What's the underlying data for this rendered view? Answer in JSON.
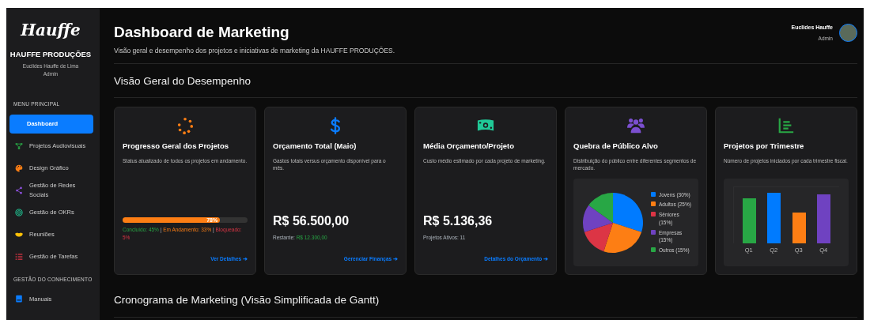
{
  "sidebar": {
    "logo": "Hauffe",
    "company": "HAUFFE PRODUÇÕES",
    "user_name": "Euclides Hauffe de Lima",
    "user_role": "Admin",
    "sections": [
      {
        "title": "MENU PRINCIPAL",
        "items": [
          {
            "label": "Dashboard",
            "selected": true
          },
          {
            "label": "Projetos Audiovisuais",
            "selected": false
          },
          {
            "label": "Design Gráfico",
            "selected": false
          },
          {
            "label": "Gestão de Redes Sociais",
            "selected": false
          },
          {
            "label": "Gestão de OKRs",
            "selected": false
          },
          {
            "label": "Reuniões",
            "selected": false
          },
          {
            "label": "Gestão de Tarefas",
            "selected": false
          }
        ]
      },
      {
        "title": "GESTÃO DO CONHECIMENTO",
        "items": [
          {
            "label": "Manuais",
            "selected": false
          }
        ]
      }
    ]
  },
  "header": {
    "title": "Dashboard de Marketing",
    "subtitle": "Visão geral e desempenho dos projetos e iniciativas de marketing da HAUFFE PRODUÇÕES.",
    "user_name": "Euclides Hauffe",
    "user_role": "Admin"
  },
  "section_title": "Visão Geral do Desempenho",
  "cards": [
    {
      "kind": "progress",
      "title": "Progresso Geral dos Projetos",
      "description": "Status atualizado de todos os projetos em andamento.",
      "level": 0.78,
      "progress_label": "78%",
      "status_parts": [
        {
          "text": "Concluído: 45%",
          "kind": "done"
        },
        {
          "text": " | ",
          "kind": "separator"
        },
        {
          "text": "Em Andamento: 33%",
          "kind": "progress"
        },
        {
          "text": " | ",
          "kind": "separator"
        },
        {
          "text": "Bloqueado: 5%",
          "kind": "blocked"
        }
      ],
      "link": "Ver Detalhes ➔"
    },
    {
      "kind": "value",
      "title": "Orçamento Total (Maio)",
      "description": "Gastos totais versus orçamento disponível para o mês.",
      "value": "R$ 56.500,00",
      "note_parts": [
        {
          "text": "Restante: ",
          "kind": "label"
        },
        {
          "text": "R$ 12.300,00",
          "kind": "positive"
        }
      ],
      "link": "Gerenciar Finanças ➔"
    },
    {
      "kind": "value",
      "title": "Média Orçamento/Projeto",
      "description": "Custo médio estimado por cada projeto de marketing.",
      "value": "R$ 5.136,36",
      "note_parts": [
        {
          "text": "Projetos Ativos: 11",
          "kind": "label"
        }
      ],
      "link": "Detalhes do Orçamento ➔"
    },
    {
      "kind": "pie",
      "title": "Quebra de Público Alvo",
      "description": "Distribuição do público entre diferentes segmentos de mercado.",
      "legend": [
        {
          "color": "#007bff"
        },
        {
          "color": "#fd7e14"
        },
        {
          "color": "#dc3545"
        },
        {
          "color": "#6f42c1"
        },
        {
          "color": "#28a745"
        }
      ],
      "chart_data": {
        "type": "pie",
        "categories": [
          "Jovens (30%)",
          "Adultos (25%)",
          "Sêniores (15%)",
          "Empresas (15%)",
          "Outros (15%)"
        ],
        "values": [
          30,
          25,
          15,
          15,
          15
        ]
      }
    },
    {
      "kind": "bars",
      "title": "Projetos por Trimestre",
      "description": "Número de projetos iniciados por cada trimestre fiscal.",
      "bars": [
        {
          "label": "Q1",
          "color": "#28a745"
        },
        {
          "label": "Q2",
          "color": "#007bff"
        },
        {
          "label": "Q3",
          "color": "#fd7e14"
        },
        {
          "label": "Q4",
          "color": "#6f42c1"
        }
      ]
    }
  ],
  "gantt_title": "Cronograma de Marketing (Visão Simplificada de Gantt)"
}
